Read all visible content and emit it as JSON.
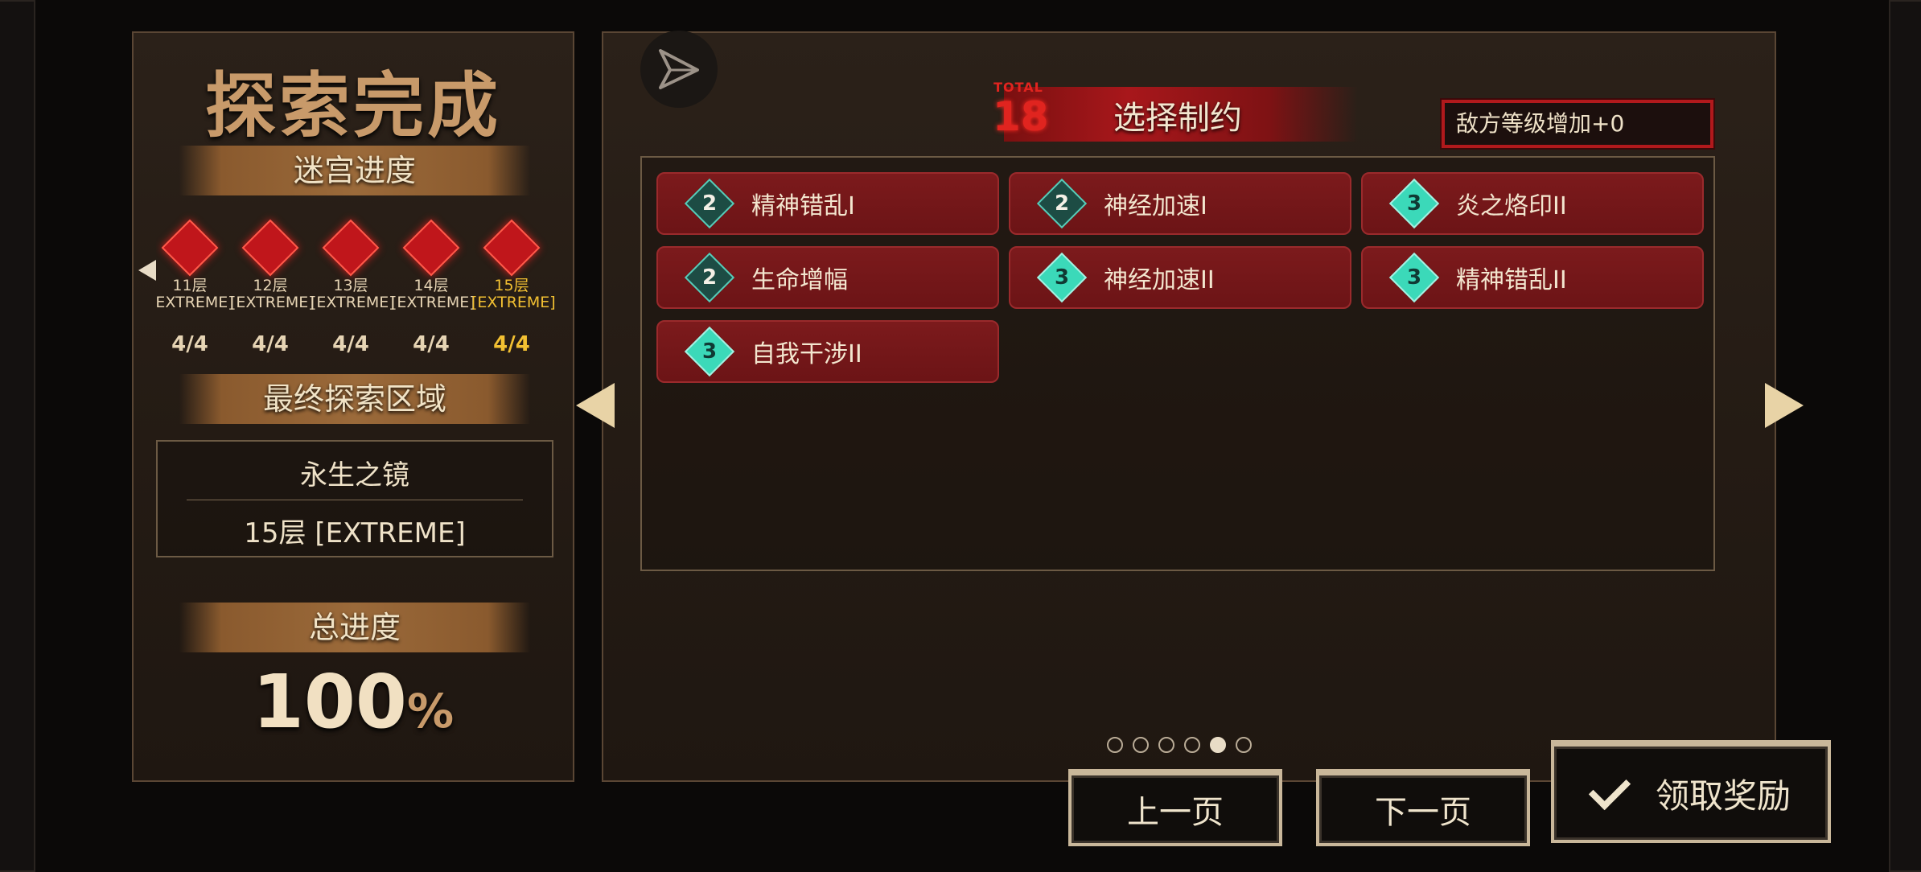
{
  "left_panel": {
    "title": "探索完成",
    "maze_progress_label": "迷宫进度",
    "floors": [
      {
        "floor": "11层",
        "mode": "[EXTREME]",
        "count": "4/4"
      },
      {
        "floor": "12层",
        "mode": "[EXTREME]",
        "count": "4/4"
      },
      {
        "floor": "13层",
        "mode": "[EXTREME]",
        "count": "4/4"
      },
      {
        "floor": "14层",
        "mode": "[EXTREME]",
        "count": "4/4"
      },
      {
        "floor": "15层",
        "mode": "[EXTREME]",
        "count": "4/4"
      }
    ],
    "final_area_label": "最终探索区域",
    "final_area_name": "永生之镜",
    "final_area_floor": "15层 [EXTREME]",
    "total_progress_label": "总进度",
    "total_progress_value": "100",
    "total_progress_unit": "%"
  },
  "right_panel": {
    "total_label": "TOTAL",
    "total_value": "18",
    "header_title": "选择制约",
    "enemy_level_text": "敌方等级增加+0",
    "restrictions": [
      {
        "level": "2",
        "name": "精神错乱I"
      },
      {
        "level": "2",
        "name": "神经加速I"
      },
      {
        "level": "3",
        "name": "炎之烙印II"
      },
      {
        "level": "2",
        "name": "生命增幅"
      },
      {
        "level": "3",
        "name": "神经加速II"
      },
      {
        "level": "3",
        "name": "精神错乱II"
      },
      {
        "level": "3",
        "name": "自我干涉II"
      }
    ],
    "pagination": {
      "pages": 6,
      "current": 5
    }
  },
  "buttons": {
    "prev": "上一页",
    "next": "下一页",
    "claim": "领取奖励"
  },
  "icons": {
    "send": "send-icon",
    "check": "check-icon",
    "arrow_left": "triangle-left-icon",
    "arrow_right": "triangle-right-icon"
  },
  "colors": {
    "accent_red": "#b1191c",
    "gold_current": "#f2c032",
    "teal_level": "#3bd9b9"
  }
}
